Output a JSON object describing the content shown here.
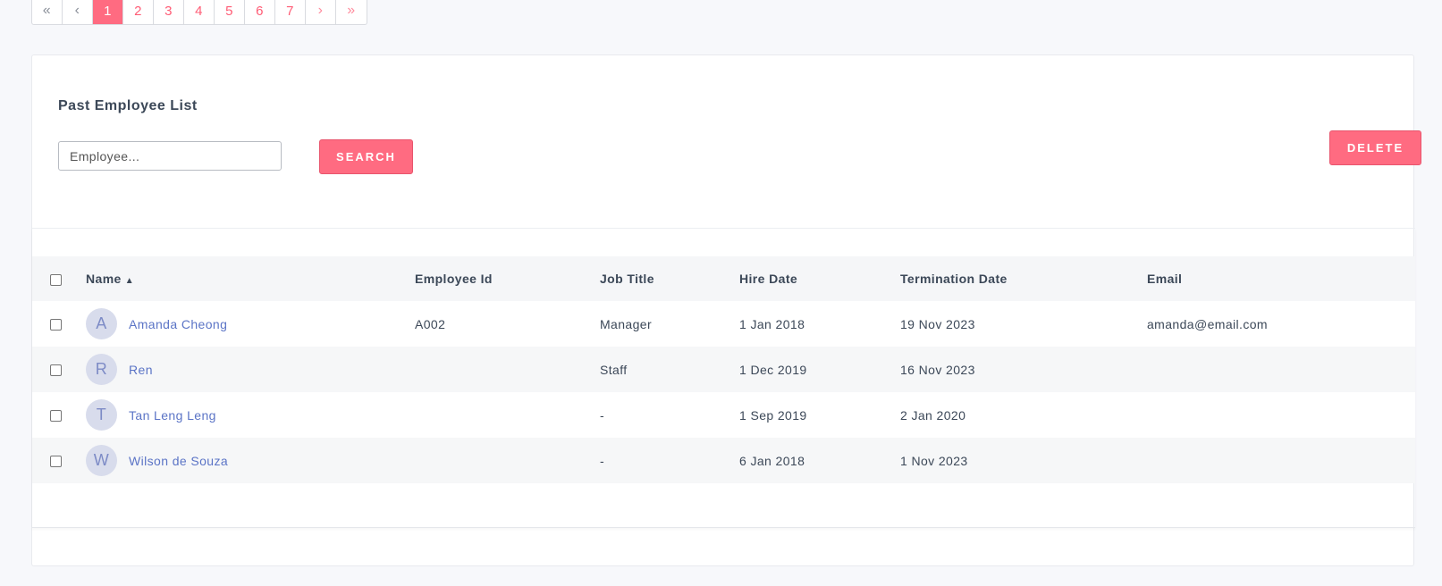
{
  "pagination": {
    "first": "«",
    "prev": "‹",
    "pages": [
      "1",
      "2",
      "3",
      "4",
      "5",
      "6",
      "7"
    ],
    "active": "1",
    "next": "›",
    "last": "»"
  },
  "card": {
    "title": "Past Employee List",
    "search_placeholder": "Employee...",
    "search_label": "SEARCH",
    "delete_label": "DELETE"
  },
  "table": {
    "headers": {
      "name": "Name",
      "sort_indicator": "▲",
      "employee_id": "Employee Id",
      "job_title": "Job Title",
      "hire_date": "Hire Date",
      "termination_date": "Termination Date",
      "email": "Email"
    },
    "rows": [
      {
        "initial": "A",
        "name": "Amanda Cheong",
        "employee_id": "A002",
        "job_title": "Manager",
        "hire_date": "1 Jan 2018",
        "termination_date": "19 Nov 2023",
        "email": "amanda@email.com"
      },
      {
        "initial": "R",
        "name": "Ren",
        "employee_id": "",
        "job_title": "Staff",
        "hire_date": "1 Dec 2019",
        "termination_date": "16 Nov 2023",
        "email": ""
      },
      {
        "initial": "T",
        "name": "Tan Leng Leng",
        "employee_id": "",
        "job_title": "-",
        "hire_date": "1 Sep 2019",
        "termination_date": "2 Jan 2020",
        "email": ""
      },
      {
        "initial": "W",
        "name": "Wilson de Souza",
        "employee_id": "",
        "job_title": "-",
        "hire_date": "6 Jan 2018",
        "termination_date": "1 Nov 2023",
        "email": ""
      }
    ]
  },
  "colors": {
    "accent": "#ff6b81",
    "link": "#5b74c6",
    "avatar_bg": "#d8dcec"
  }
}
